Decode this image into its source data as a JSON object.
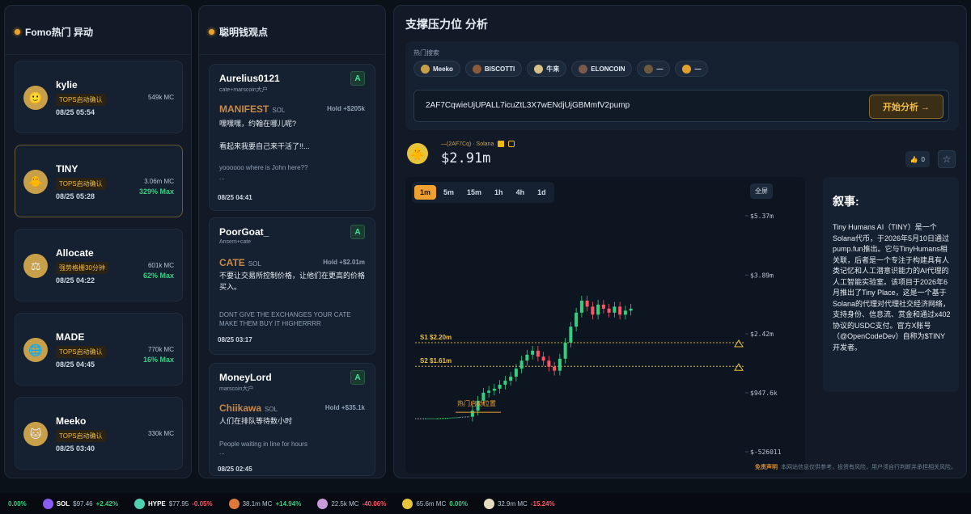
{
  "fomo": {
    "title": "Fomo热门 异动",
    "items": [
      {
        "name": "kylie",
        "badge": "TOPS启动确认",
        "time": "08/25 05:54",
        "mc": "549k MC",
        "max": "",
        "icon": "🙂"
      },
      {
        "name": "TINY",
        "badge": "TOPS启动确认",
        "time": "08/25 05:28",
        "mc": "3.06m MC",
        "max": "329% Max",
        "icon": "🐥"
      },
      {
        "name": "Allocate",
        "badge": "强势格栅30分钟",
        "time": "08/25 04:22",
        "mc": "601k MC",
        "max": "62% Max",
        "icon": "⚖"
      },
      {
        "name": "MADE",
        "badge": "TOPS启动确认",
        "time": "08/25 04:45",
        "mc": "770k MC",
        "max": "16% Max",
        "icon": "🌐"
      },
      {
        "name": "Meeko",
        "badge": "TOPS启动确认",
        "time": "08/25 03:40",
        "mc": "330k MC",
        "max": "",
        "icon": "🐱"
      }
    ]
  },
  "smart": {
    "title": "聪明钱观点",
    "items": [
      {
        "user": "Aurelius0121",
        "sub": "cate+marscoin大户",
        "grade": "A",
        "token": "MANIFEST",
        "chain": "SOL",
        "hold": "Hold +$205k",
        "text1": "嘿嘿嘿，约翰在哪儿呢?",
        "text2": "看起来我要自己来干活了!!...",
        "en": "yoooooo where is John here??",
        "en2": "...",
        "time": "08/25 04:41"
      },
      {
        "user": "PoorGoat_",
        "sub": "Ansem+cate",
        "grade": "A",
        "token": "CATE",
        "chain": "SOL",
        "hold": "Hold +$2.01m",
        "text1": "不要让交易所控制价格，让他们在更高的价格买入。",
        "text2": "",
        "en": "DONT GIVE THE EXCHANGES YOUR CATE MAKE THEM BUY IT HIGHERRRR",
        "en2": "",
        "time": "08/25 03:17"
      },
      {
        "user": "MoneyLord",
        "sub": "marscoin大户",
        "grade": "A",
        "token": "Chiikawa",
        "chain": "SOL",
        "hold": "Hold +$35.1k",
        "text1": "人们在排队等待数小时",
        "text2": "",
        "en": "People waiting in line for hours",
        "en2": "...",
        "time": "08/25 02:45"
      }
    ]
  },
  "analysis": {
    "title": "支撑压力位 分析",
    "hot_label": "热门搜索",
    "chips": [
      "Meeko",
      "BISCOTTI",
      "牛来",
      "ELONCOIN",
      "—",
      "—"
    ],
    "address": "2AF7CqwieUjUPALL7icuZtL3X7wENdjUjGBMmfV2pump",
    "start_label": "开始分析 →",
    "token_meta": "—(2AF7Cq) · Solana",
    "price": "$2.91m",
    "likes": "0",
    "timeframes": [
      "1m",
      "5m",
      "15m",
      "1h",
      "4h",
      "1d"
    ],
    "active_tf": "1m",
    "full_label": "全屏",
    "story_title": "叙事:",
    "story_text": "Tiny Humans AI（TINY）是一个Solana代币，于2026年5月10日通过pump.fun推出。它与TinyHumans相关联，后者是一个专注于构建具有人类记忆和人工潜意识能力的AI代理的人工智能实验室。该项目于2026年6月推出了Tiny Place，这是一个基于Solana的代理对代理社交经济网络，支持身份、信息流、赏金和通过x402协议的USDC支付。官方X账号（@OpenCodeDev）自称为$TINY开发者。",
    "disclaimer_label": "免责声明",
    "disclaimer_text": "本网站信息仅供参考，投资有风险，用户须自行判断并承担相关风险。"
  },
  "chart_data": {
    "type": "line",
    "y_ticks": [
      "$5.37m",
      "$3.89m",
      "$2.42m",
      "$947.6k",
      "$-526011"
    ],
    "levels": [
      {
        "name": "S1",
        "value": "$2.20m",
        "v": 2.2
      },
      {
        "name": "S2",
        "value": "$1.61m",
        "v": 1.61
      }
    ],
    "annotation": "热门启动位置",
    "ylim": [
      -0.526,
      5.37
    ],
    "x": [
      0,
      4,
      8,
      12,
      16,
      20,
      22,
      24,
      26,
      28,
      30,
      32,
      34,
      36,
      38,
      40,
      42,
      44,
      46,
      48,
      50,
      52,
      54,
      56,
      58,
      60,
      62,
      64,
      66,
      68,
      70,
      72,
      74,
      76,
      78,
      80
    ],
    "y": [
      0.3,
      0.3,
      0.3,
      0.31,
      0.33,
      0.35,
      0.5,
      0.75,
      0.95,
      1.0,
      1.05,
      1.15,
      1.25,
      1.35,
      1.55,
      1.75,
      1.9,
      2.0,
      1.85,
      1.75,
      1.6,
      1.5,
      1.8,
      2.2,
      2.6,
      2.95,
      3.25,
      3.1,
      2.9,
      3.15,
      3.05,
      2.95,
      3.1,
      2.9,
      3.0,
      3.05
    ]
  },
  "ticker": [
    {
      "name": "",
      "val": "",
      "chg": "0.00%",
      "dir": "up",
      "color": "#35d07f"
    },
    {
      "name": "SOL",
      "val": "$97.46",
      "chg": "+2.42%",
      "dir": "up",
      "color": "#8a5cf6"
    },
    {
      "name": "HYPE",
      "val": "$77.95",
      "chg": "-0.05%",
      "dir": "down",
      "color": "#4fd1b0"
    },
    {
      "name": "",
      "val": "38.1m MC",
      "chg": "+14.94%",
      "dir": "up",
      "color": "#e0783a"
    },
    {
      "name": "",
      "val": "22.5k MC",
      "chg": "-40.06%",
      "dir": "down",
      "color": "#c79ad8"
    },
    {
      "name": "",
      "val": "65.6m MC",
      "chg": "0.00%",
      "dir": "up",
      "color": "#e8c43a"
    },
    {
      "name": "",
      "val": "32.9m MC",
      "chg": "-15.24%",
      "dir": "down",
      "color": "#e6dcc0"
    }
  ]
}
